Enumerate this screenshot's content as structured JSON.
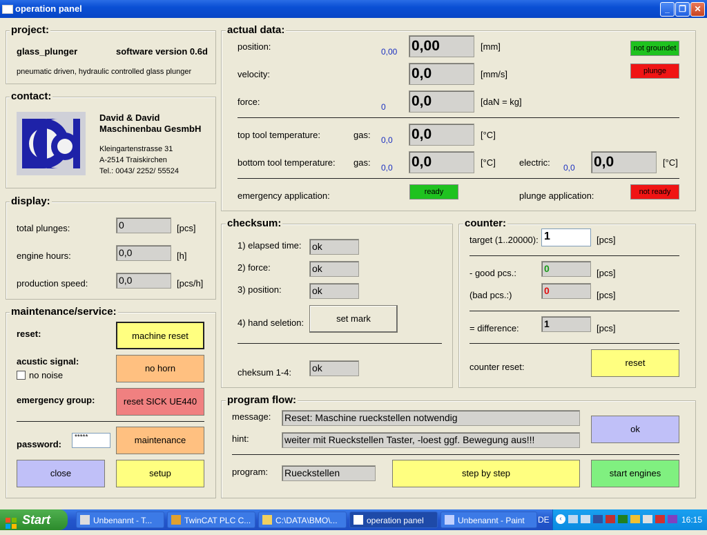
{
  "window": {
    "title": "operation panel"
  },
  "project": {
    "heading": "project:",
    "name": "glass_plunger",
    "version": "software version 0.6d",
    "description": "pneumatic driven, hydraulic controlled glass plunger"
  },
  "contact": {
    "heading": "contact:",
    "company_line1": "David & David",
    "company_line2": "Maschinenbau GesmbH",
    "street": "Kleingartenstrasse 31",
    "city": "A-2514 Traiskirchen",
    "phone": "Tel.: 0043/ 2252/ 55524"
  },
  "display": {
    "heading": "display:",
    "total_plunges": {
      "label": "total plunges:",
      "value": "0",
      "unit": "[pcs]"
    },
    "engine_hours": {
      "label": "engine hours:",
      "value": "0,0",
      "unit": "[h]"
    },
    "production_speed": {
      "label": "production speed:",
      "value": "0,0",
      "unit": "[pcs/h]"
    }
  },
  "maintenance": {
    "heading": "maintenance/service:",
    "reset_label": "reset:",
    "machine_reset": "machine reset",
    "acustic_label": "acustic signal:",
    "no_noise": "no noise",
    "no_horn": "no horn",
    "emergency_label": "emergency group:",
    "reset_sick": "reset SICK UE440",
    "password_label": "password:",
    "password_value": "*****",
    "maintenance_button": "maintenance",
    "close_button": "close",
    "setup_button": "setup"
  },
  "actual": {
    "heading": "actual data:",
    "position": {
      "label": "position:",
      "small": "0,00",
      "value": "0,00",
      "unit": "[mm]"
    },
    "velocity": {
      "label": "velocity:",
      "value": "0,0",
      "unit": "[mm/s]"
    },
    "force": {
      "label": "force:",
      "small": "0",
      "value": "0,0",
      "unit": "[daN = kg]"
    },
    "not_grounded": "not groundet",
    "plunge": "plunge",
    "top_tool": {
      "label": "top tool temperature:",
      "gas": "gas:",
      "small": "0,0",
      "value": "0,0",
      "unit": "[°C]"
    },
    "bottom_tool": {
      "label": "bottom tool temperature:",
      "gas": "gas:",
      "small": "0,0",
      "value": "0,0",
      "unit": "[°C]",
      "electric": "electric:",
      "small2": "0,0",
      "value2": "0,0",
      "unit2": "[°C]"
    },
    "emergency_app": {
      "label": "emergency application:",
      "status": "ready"
    },
    "plunge_app": {
      "label": "plunge application:",
      "status": "not ready"
    }
  },
  "checksum": {
    "heading": "checksum:",
    "elapsed": {
      "label": "1) elapsed time:",
      "value": "ok"
    },
    "force": {
      "label": "2) force:",
      "value": "ok"
    },
    "position": {
      "label": "3) position:",
      "value": "ok"
    },
    "hand": {
      "label": "4) hand seletion:",
      "button": "set mark"
    },
    "total": {
      "label": "cheksum 1-4:",
      "value": "ok"
    }
  },
  "counter": {
    "heading": "counter:",
    "target": {
      "label": "target (1..20000):",
      "value": "1",
      "unit": "[pcs]"
    },
    "good": {
      "label": "- good pcs.:",
      "value": "0",
      "unit": "[pcs]"
    },
    "bad": {
      "label": "(bad pcs.:)",
      "value": "0",
      "unit": "[pcs]"
    },
    "difference": {
      "label": "= difference:",
      "value": "1",
      "unit": "[pcs]"
    },
    "reset_label": "counter reset:",
    "reset_button": "reset"
  },
  "program_flow": {
    "heading": "program flow:",
    "message_label": "message:",
    "message": "Reset: Maschine rueckstellen notwendig",
    "hint_label": "hint:",
    "hint": "weiter mit Rueckstellen Taster, -loest ggf. Bewegung aus!!!",
    "ok_button": "ok",
    "program_label": "program:",
    "program": "Rueckstellen",
    "step_button": "step by step",
    "start_button": "start engines"
  },
  "taskbar": {
    "start": "Start",
    "items": [
      "Unbenannt - T...",
      "TwinCAT PLC C...",
      "C:\\DATA\\BMO\\...",
      "operation panel",
      "Unbenannt - Paint"
    ],
    "lang": "DE",
    "clock": "16:15"
  },
  "colors": {
    "green": "#1fc21f",
    "red": "#f01414",
    "yellow": "#ffff80",
    "orange": "#ffc080",
    "pink": "#f08080",
    "lavender": "#c0c0f8",
    "lightgreen": "#80f080"
  }
}
